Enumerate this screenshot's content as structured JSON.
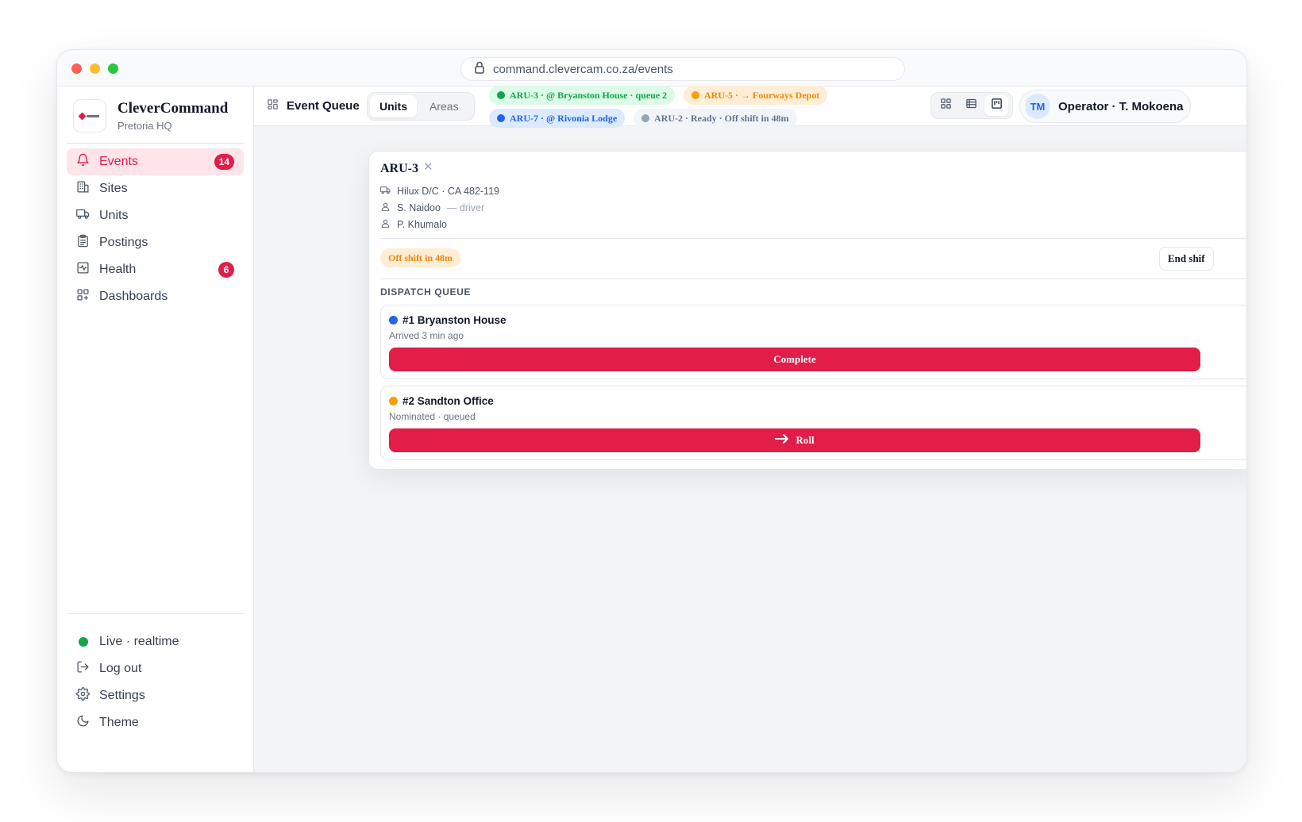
{
  "browser": {
    "url": "command.clevercam.co.za/events"
  },
  "brand": {
    "name": "CleverCommand",
    "subtitle": "Pretoria HQ"
  },
  "sidebar": {
    "items": [
      {
        "label": "Events",
        "icon": "bell-icon",
        "badge": "14",
        "active": true
      },
      {
        "label": "Sites",
        "icon": "building-icon"
      },
      {
        "label": "Units",
        "icon": "truck-icon"
      },
      {
        "label": "Postings",
        "icon": "clipboard-icon"
      },
      {
        "label": "Health",
        "icon": "activity-icon",
        "badge": "6"
      },
      {
        "label": "Dashboards",
        "icon": "dashboard-grid-icon"
      }
    ],
    "footer": {
      "status": "Live · realtime",
      "logout": "Log out",
      "settings": "Settings",
      "theme": "Theme"
    }
  },
  "topbar": {
    "title": "Event Queue",
    "segments": [
      "Units",
      "Areas"
    ],
    "active_segment": "Units",
    "unit_chips": [
      {
        "label": "ARU-3 · @ Bryanston House · queue 2",
        "status": "green"
      },
      {
        "label": "ARU-5 · → Fourways Depot",
        "status": "orange"
      },
      {
        "label": "ARU-7 · @ Rivonia Lodge",
        "status": "blue"
      },
      {
        "label": "ARU-2 · Ready · Off shift in 48m",
        "status": "gray"
      }
    ],
    "view_modes": [
      "grid-view-icon",
      "list-view-icon",
      "board-view-icon"
    ],
    "active_view": "board-view-icon",
    "operator": {
      "initials": "TM",
      "label": "Operator · T. Mokoena"
    }
  },
  "colors": {
    "accent": "#e11d48",
    "green": "#16a34a",
    "orange": "#f59e0b",
    "blue": "#2563eb",
    "gray": "#94a3b8"
  },
  "unit_card": {
    "title": "ARU-3",
    "vehicle": "Hilux D/C · CA 482-119",
    "crew": [
      {
        "name": "S. Naidoo",
        "role": "— driver"
      },
      {
        "name": "P. Khumalo",
        "role": ""
      }
    ],
    "shift_status": "Off shift in 48m",
    "end_shift_label": "End shif",
    "dispatch_label": "DISPATCH QUEUE",
    "queue": [
      {
        "title": "#1 Bryanston House",
        "subtitle": "Arrived 3 min ago",
        "action": "Complete",
        "status": "blue"
      },
      {
        "title": "#2 Sandton Office",
        "subtitle": "Nominated · queued",
        "action": "Roll",
        "status": "orange"
      }
    ]
  }
}
